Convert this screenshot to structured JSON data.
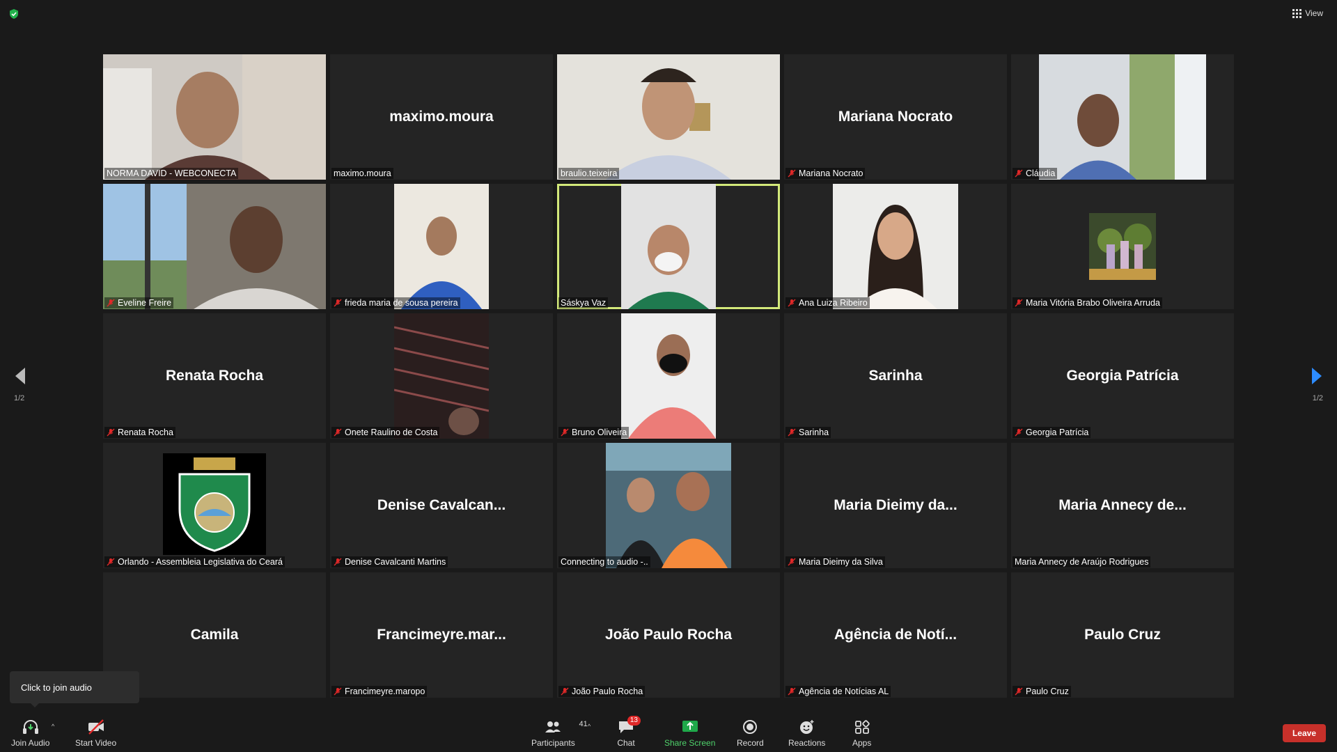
{
  "header": {
    "view_label": "View"
  },
  "navigation": {
    "page_left": "1/2",
    "page_right": "1/2"
  },
  "tooltip": {
    "text": "Click to join audio"
  },
  "tiles": [
    {
      "label": "NORMA DAVID - WEBCONECTA",
      "muted": false,
      "display": ""
    },
    {
      "label": "maximo.moura",
      "muted": false,
      "display": "maximo.moura"
    },
    {
      "label": "braulio.teixeira",
      "muted": false,
      "display": ""
    },
    {
      "label": "Mariana Nocrato",
      "muted": true,
      "display": "Mariana Nocrato"
    },
    {
      "label": "Cláudia",
      "muted": true,
      "display": ""
    },
    {
      "label": "Eveline Freire",
      "muted": true,
      "display": ""
    },
    {
      "label": "frieda maria de sousa pereira",
      "muted": true,
      "display": ""
    },
    {
      "label": "Sáskya Vaz",
      "muted": false,
      "display": "",
      "active": true
    },
    {
      "label": "Ana Luiza Ribeiro",
      "muted": true,
      "display": ""
    },
    {
      "label": "Maria Vitória Brabo Oliveira Arruda",
      "muted": true,
      "display": ""
    },
    {
      "label": "Renata Rocha",
      "muted": true,
      "display": "Renata Rocha"
    },
    {
      "label": "Onete Raulino de Costa",
      "muted": true,
      "display": ""
    },
    {
      "label": "Bruno Oliveira",
      "muted": true,
      "display": ""
    },
    {
      "label": "Sarinha",
      "muted": true,
      "display": "Sarinha"
    },
    {
      "label": "Georgia Patrícia",
      "muted": true,
      "display": "Georgia Patrícia"
    },
    {
      "label": "Orlando - Assembleia Legislativa do Ceará",
      "muted": true,
      "display": ""
    },
    {
      "label": "Denise Cavalcanti Martins",
      "muted": true,
      "display": "Denise  Cavalcan..."
    },
    {
      "label": "Connecting to audio -..",
      "muted": false,
      "display": ""
    },
    {
      "label": "Maria Dieimy da Silva",
      "muted": true,
      "display": "Maria  Dieimy  da..."
    },
    {
      "label": "Maria Annecy de Araújo Rodrigues",
      "muted": false,
      "display": "Maria  Annecy  de..."
    },
    {
      "label": "",
      "muted": false,
      "display": "Camila"
    },
    {
      "label": "Francimeyre.maropo",
      "muted": true,
      "display": "Francimeyre.mar..."
    },
    {
      "label": "João Paulo Rocha",
      "muted": true,
      "display": "João Paulo Rocha"
    },
    {
      "label": "Agência de Notícias AL",
      "muted": true,
      "display": "Agência  de  Notí..."
    },
    {
      "label": "Paulo Cruz",
      "muted": true,
      "display": "Paulo Cruz"
    }
  ],
  "toolbar": {
    "join_audio": "Join Audio",
    "start_video": "Start Video",
    "participants": "Participants",
    "participants_count": "41",
    "chat": "Chat",
    "chat_badge": "13",
    "share_screen": "Share Screen",
    "record": "Record",
    "reactions": "Reactions",
    "apps": "Apps",
    "leave": "Leave"
  },
  "colors": {
    "active_border": "#d3e97a",
    "share_green": "#4fd26b",
    "leave_red": "#c7302a",
    "mute_red": "#e02828"
  }
}
